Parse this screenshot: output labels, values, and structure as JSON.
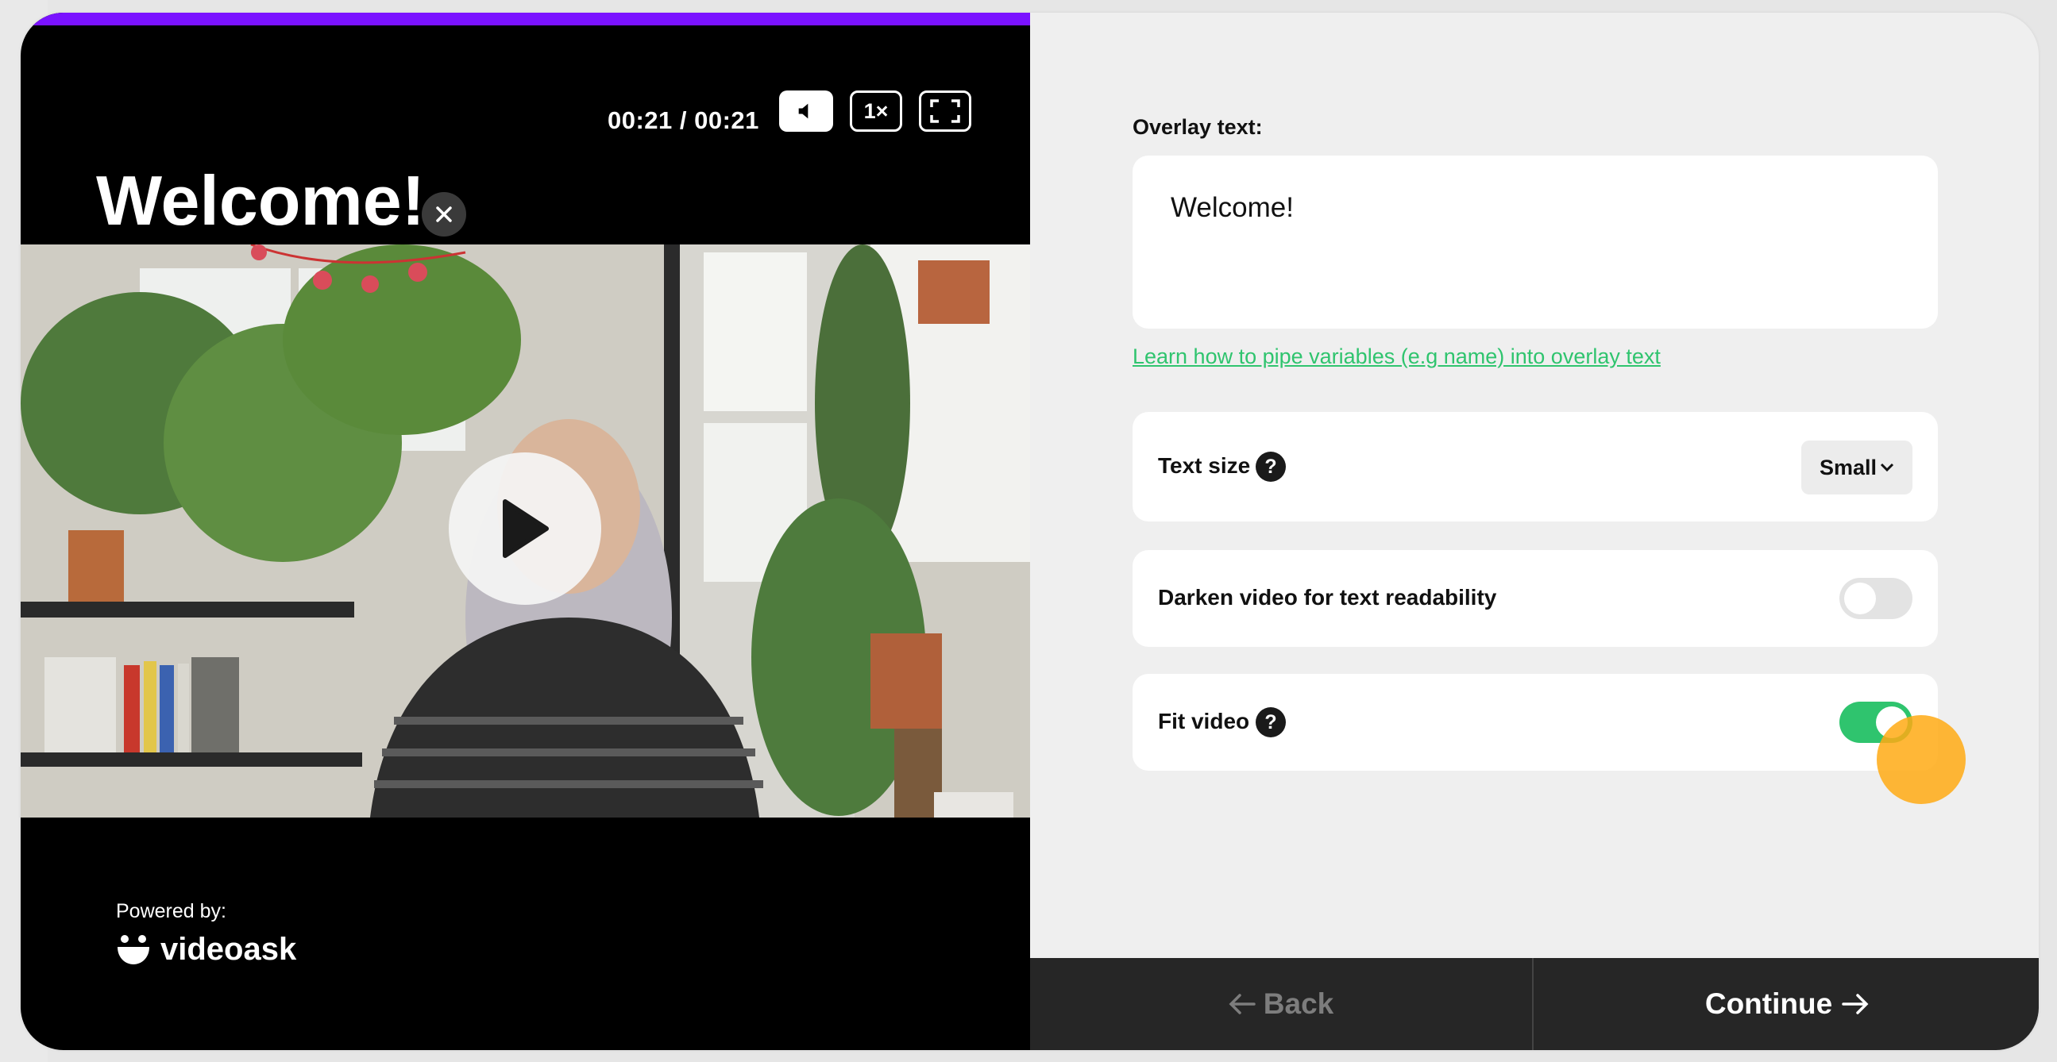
{
  "player": {
    "progress_fraction": 1.0,
    "progress_color": "#7a12ff",
    "time": "00:21 / 00:21",
    "mute_icon": "speaker-icon",
    "speed_label": "1×",
    "fullscreen_icon": "fullscreen-icon",
    "overlay_title": "Welcome!",
    "close_icon": "close-icon",
    "play_icon": "play-icon",
    "powered_by": "Powered by:",
    "brand_name": "videoask"
  },
  "panel": {
    "overlay_label": "Overlay text:",
    "overlay_value": "Welcome!",
    "pipe_link": "Learn how to pipe variables (e.g name) into overlay text",
    "text_size_label": "Text size",
    "help_glyph": "?",
    "text_size_value": "Small",
    "darken_label": "Darken video for text readability",
    "darken_on": false,
    "fit_label": "Fit video",
    "fit_on": true,
    "toggle_on_color": "#2fc46e",
    "toggle_off_color": "#e3e3e3"
  },
  "footer": {
    "back_label": "Back",
    "continue_label": "Continue"
  }
}
